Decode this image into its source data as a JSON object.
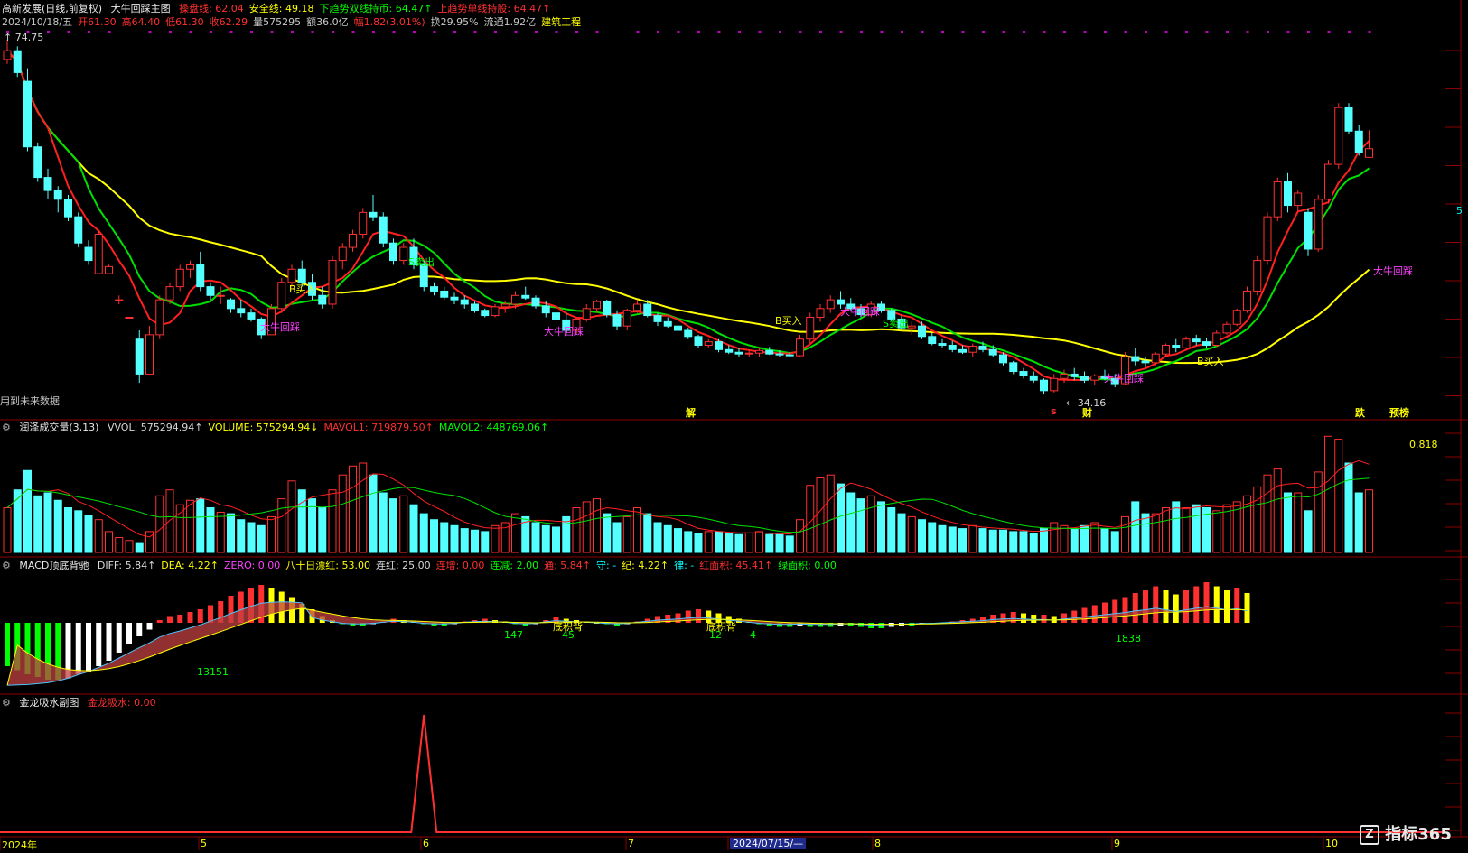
{
  "header": {
    "stock": "高新发展(日线,前复权)",
    "indicator": "大牛回踩主图",
    "params": [
      {
        "text": "操盘线: 62.04",
        "color": "#ff3030"
      },
      {
        "text": "安全线: 49.18",
        "color": "#ffff00"
      },
      {
        "text": "下趋势双线持币: 64.47↑",
        "color": "#00ff00"
      },
      {
        "text": "上趋势单线持股: 64.47↑",
        "color": "#ff3030"
      }
    ],
    "row2": [
      {
        "text": "2024/10/18/五",
        "color": "#c8c8c8"
      },
      {
        "text": "开61.30",
        "color": "#ff3030"
      },
      {
        "text": "高64.40",
        "color": "#ff3030"
      },
      {
        "text": "低61.30",
        "color": "#ff3030"
      },
      {
        "text": "收62.29",
        "color": "#ff3030"
      },
      {
        "text": "量575295",
        "color": "#c8c8c8"
      },
      {
        "text": "额36.0亿",
        "color": "#c8c8c8"
      },
      {
        "text": "幅1.82(3.01%)",
        "color": "#ff3030"
      },
      {
        "text": "换29.95%",
        "color": "#c8c8c8"
      },
      {
        "text": "流通1.92亿",
        "color": "#c8c8c8"
      },
      {
        "text": "建筑工程",
        "color": "#ffff00"
      }
    ]
  },
  "main": {
    "high_label": "74.75",
    "low_label": "34.16",
    "future_note": "用到未来数据",
    "signals": [
      {
        "text": "大牛回踩",
        "color": "#ff40ff"
      },
      {
        "text": "B买入",
        "color": "#ffff00"
      },
      {
        "text": "S卖出",
        "color": "#00ff00"
      },
      {
        "text": "大牛回踩",
        "color": "#ff40ff"
      },
      {
        "text": "B买入",
        "color": "#ffff00"
      },
      {
        "text": "大牛回踩",
        "color": "#ff40ff"
      },
      {
        "text": "S卖出",
        "color": "#00ff00"
      },
      {
        "text": "大牛回踩",
        "color": "#ff40ff"
      },
      {
        "text": "B买入",
        "color": "#ffff00"
      },
      {
        "text": "大牛回踩",
        "color": "#ff40ff"
      }
    ],
    "events": [
      {
        "text": "解",
        "color": "#ffff00"
      },
      {
        "text": "s",
        "color": "#ff3030"
      },
      {
        "text": "财",
        "color": "#ffff00"
      },
      {
        "text": "跌",
        "color": "#ffff00"
      },
      {
        "text": "预榜",
        "color": "#ffff00"
      }
    ],
    "right_mark": "5"
  },
  "volume": {
    "title": "润泽成交量(3,13)",
    "items": [
      {
        "text": "VVOL: 575294.94↑",
        "color": "#d8d8d8"
      },
      {
        "text": "VOLUME: 575294.94↓",
        "color": "#ffff00"
      },
      {
        "text": "MAVOL1: 719879.50↑",
        "color": "#ff3030"
      },
      {
        "text": "MAVOL2: 448769.06↑",
        "color": "#00ff00"
      }
    ],
    "peak_label": "0.818"
  },
  "macd": {
    "title": "MACD顶底背驰",
    "items": [
      {
        "text": "DIFF: 5.84↑",
        "color": "#d8d8d8"
      },
      {
        "text": "DEA: 4.22↑",
        "color": "#ffff00"
      },
      {
        "text": "ZERO: 0.00",
        "color": "#ff40ff"
      },
      {
        "text": "八十日漂红: 53.00",
        "color": "#ffff00"
      },
      {
        "text": "连红: 25.00",
        "color": "#d8d8d8"
      },
      {
        "text": "连增: 0.00",
        "color": "#ff3030"
      },
      {
        "text": "连减: 2.00",
        "color": "#00ff00"
      },
      {
        "text": "通: 5.84↑",
        "color": "#ff3030"
      },
      {
        "text": "守: -",
        "color": "#00ffff"
      },
      {
        "text": "纪: 4.22↑",
        "color": "#ffff00"
      },
      {
        "text": "律: -",
        "color": "#00ffff"
      },
      {
        "text": "红面积: 45.41↑",
        "color": "#ff3030"
      },
      {
        "text": "绿面积: 0.00",
        "color": "#00ff00"
      }
    ],
    "marks": [
      "13151",
      "147",
      "45",
      "12",
      "4",
      "1838"
    ],
    "bei": [
      "底积背",
      "底积背"
    ]
  },
  "jl": {
    "title": "金龙吸水副图",
    "value": "金龙吸水: 0.00"
  },
  "xaxis": {
    "labels": [
      "2024年",
      "5",
      "6",
      "7",
      "2024/07/15/—",
      "8",
      "9",
      "10"
    ]
  },
  "watermark": "指标365",
  "colors": {
    "up": "#ff3030",
    "down": "#54ffff",
    "ma_fast": "#ff2020",
    "ma_slow": "#00e000",
    "ma_long": "#ffff00",
    "border": "#8b0000"
  },
  "chart_data": {
    "type": "candlestick",
    "candles": [
      [
        72.5,
        74.75,
        72.0,
        73.5
      ],
      [
        73.5,
        74.0,
        70.5,
        71.0
      ],
      [
        70.0,
        71.5,
        62.0,
        62.5
      ],
      [
        62.5,
        63.0,
        58.5,
        59.0
      ],
      [
        59.0,
        60.0,
        56.5,
        57.5
      ],
      [
        57.5,
        58.0,
        55.0,
        56.5
      ],
      [
        56.5,
        57.0,
        54.0,
        54.5
      ],
      [
        54.5,
        55.0,
        51.0,
        51.5
      ],
      [
        51.0,
        51.8,
        49.0,
        49.5
      ],
      [
        48.0,
        53.0,
        48.0,
        52.5
      ],
      [
        48.0,
        49.0,
        48.0,
        48.8
      ],
      [
        45.0,
        45.5,
        44.5,
        45.0
      ],
      [
        43.0,
        43.0,
        43.0,
        43.0
      ],
      [
        40.5,
        41.5,
        35.5,
        36.5
      ],
      [
        36.5,
        42.0,
        36.5,
        41.0
      ],
      [
        41.0,
        45.5,
        40.5,
        45.0
      ],
      [
        45.0,
        47.0,
        44.5,
        46.5
      ],
      [
        46.5,
        49.0,
        46.0,
        48.5
      ],
      [
        48.5,
        49.5,
        47.5,
        49.0
      ],
      [
        49.0,
        50.5,
        46.0,
        46.5
      ],
      [
        46.5,
        47.0,
        45.0,
        45.5
      ],
      [
        45.5,
        46.5,
        44.5,
        45.5
      ],
      [
        45.0,
        45.2,
        43.5,
        44.0
      ],
      [
        44.0,
        45.0,
        43.0,
        43.5
      ],
      [
        43.5,
        44.0,
        42.5,
        42.8
      ],
      [
        42.8,
        43.0,
        40.5,
        41.0
      ],
      [
        41.0,
        44.5,
        41.0,
        44.0
      ],
      [
        44.0,
        47.5,
        43.5,
        47.0
      ],
      [
        47.0,
        49.0,
        46.5,
        48.5
      ],
      [
        48.5,
        49.5,
        46.5,
        47.0
      ],
      [
        47.0,
        48.0,
        45.0,
        45.5
      ],
      [
        45.5,
        46.5,
        44.0,
        44.5
      ],
      [
        44.5,
        50.0,
        44.0,
        49.5
      ],
      [
        49.5,
        51.5,
        48.5,
        51.0
      ],
      [
        51.0,
        53.0,
        50.5,
        52.5
      ],
      [
        52.5,
        55.5,
        52.0,
        55.0
      ],
      [
        55.0,
        57.0,
        54.0,
        54.5
      ],
      [
        54.5,
        55.0,
        51.0,
        51.5
      ],
      [
        51.5,
        52.0,
        49.0,
        49.5
      ],
      [
        49.5,
        51.5,
        49.0,
        51.0
      ],
      [
        51.0,
        52.0,
        48.5,
        49.0
      ],
      [
        49.0,
        49.5,
        46.0,
        46.5
      ],
      [
        46.5,
        47.0,
        45.5,
        46.0
      ],
      [
        46.0,
        46.5,
        45.0,
        45.3
      ],
      [
        45.3,
        45.8,
        44.5,
        45.0
      ],
      [
        45.0,
        45.5,
        44.0,
        44.5
      ],
      [
        44.5,
        44.8,
        43.5,
        43.8
      ],
      [
        43.8,
        44.0,
        43.0,
        43.2
      ],
      [
        43.2,
        44.5,
        43.0,
        44.2
      ],
      [
        44.2,
        44.8,
        43.5,
        44.5
      ],
      [
        44.5,
        46.0,
        44.0,
        45.5
      ],
      [
        45.5,
        46.5,
        45.0,
        45.2
      ],
      [
        45.2,
        45.5,
        44.0,
        44.3
      ],
      [
        44.3,
        44.8,
        43.0,
        43.5
      ],
      [
        43.5,
        44.0,
        42.5,
        42.7
      ],
      [
        42.7,
        43.5,
        41.0,
        41.5
      ],
      [
        41.5,
        43.0,
        41.0,
        42.8
      ],
      [
        42.8,
        44.5,
        42.5,
        44.0
      ],
      [
        44.0,
        45.0,
        43.5,
        44.8
      ],
      [
        44.8,
        45.0,
        43.0,
        43.3
      ],
      [
        43.3,
        43.8,
        41.5,
        42.0
      ],
      [
        42.0,
        44.0,
        41.5,
        43.8
      ],
      [
        43.8,
        45.0,
        43.5,
        44.5
      ],
      [
        44.5,
        45.0,
        43.0,
        43.2
      ],
      [
        43.2,
        43.5,
        42.0,
        42.5
      ],
      [
        42.5,
        43.0,
        41.8,
        42.0
      ],
      [
        42.0,
        42.5,
        41.0,
        41.5
      ],
      [
        41.5,
        41.8,
        40.5,
        40.8
      ],
      [
        40.8,
        41.0,
        39.5,
        39.8
      ],
      [
        39.8,
        40.5,
        39.5,
        40.2
      ],
      [
        40.2,
        40.5,
        39.0,
        39.3
      ],
      [
        39.3,
        39.8,
        38.8,
        39.0
      ],
      [
        39.0,
        39.5,
        38.5,
        38.8
      ],
      [
        38.8,
        39.2,
        38.5,
        38.9
      ],
      [
        38.9,
        39.5,
        38.5,
        39.2
      ],
      [
        39.2,
        39.6,
        38.7,
        38.8
      ],
      [
        38.8,
        39.2,
        38.5,
        38.7
      ],
      [
        38.7,
        39.0,
        38.4,
        38.6
      ],
      [
        38.6,
        41.0,
        38.5,
        40.5
      ],
      [
        40.5,
        43.5,
        40.0,
        43.0
      ],
      [
        43.0,
        44.5,
        42.5,
        44.0
      ],
      [
        44.0,
        45.5,
        43.5,
        45.0
      ],
      [
        45.0,
        46.0,
        44.0,
        44.5
      ],
      [
        44.5,
        45.2,
        43.8,
        44.0
      ],
      [
        44.0,
        44.5,
        43.0,
        43.3
      ],
      [
        43.3,
        44.8,
        43.0,
        44.5
      ],
      [
        44.5,
        44.8,
        43.5,
        43.8
      ],
      [
        43.8,
        44.0,
        42.5,
        42.8
      ],
      [
        42.8,
        43.2,
        41.5,
        41.8
      ],
      [
        41.8,
        42.5,
        41.0,
        42.0
      ],
      [
        42.0,
        42.5,
        40.5,
        40.8
      ],
      [
        40.8,
        41.2,
        39.8,
        40.0
      ],
      [
        40.0,
        40.5,
        39.5,
        39.8
      ],
      [
        39.8,
        40.3,
        39.0,
        39.3
      ],
      [
        39.3,
        39.8,
        38.8,
        39.0
      ],
      [
        39.0,
        40.0,
        38.5,
        39.7
      ],
      [
        39.7,
        40.2,
        39.0,
        39.3
      ],
      [
        39.3,
        39.8,
        38.5,
        38.7
      ],
      [
        38.7,
        39.0,
        37.5,
        37.8
      ],
      [
        37.8,
        38.0,
        36.5,
        36.8
      ],
      [
        36.8,
        37.2,
        36.0,
        36.3
      ],
      [
        36.3,
        36.8,
        35.5,
        35.8
      ],
      [
        35.8,
        36.0,
        34.16,
        34.6
      ],
      [
        34.6,
        36.5,
        34.4,
        36.0
      ],
      [
        36.0,
        37.0,
        35.5,
        36.5
      ],
      [
        36.5,
        37.2,
        35.8,
        36.2
      ],
      [
        36.2,
        36.8,
        35.5,
        35.8
      ],
      [
        35.8,
        36.5,
        35.3,
        36.3
      ],
      [
        36.3,
        37.0,
        35.8,
        36.0
      ],
      [
        36.0,
        36.5,
        35.0,
        35.4
      ],
      [
        35.4,
        39.0,
        35.2,
        38.5
      ],
      [
        38.5,
        39.5,
        37.5,
        38.0
      ],
      [
        38.0,
        38.5,
        37.3,
        37.8
      ],
      [
        37.8,
        39.0,
        37.5,
        38.8
      ],
      [
        38.8,
        40.0,
        38.5,
        39.8
      ],
      [
        39.8,
        40.5,
        39.0,
        39.5
      ],
      [
        39.5,
        40.8,
        39.3,
        40.5
      ],
      [
        40.5,
        41.0,
        39.8,
        40.2
      ],
      [
        40.2,
        40.6,
        39.5,
        39.8
      ],
      [
        39.8,
        41.5,
        39.6,
        41.2
      ],
      [
        41.2,
        42.5,
        41.0,
        42.2
      ],
      [
        42.2,
        44.0,
        42.0,
        43.8
      ],
      [
        43.8,
        46.5,
        43.5,
        46.0
      ],
      [
        46.0,
        50.0,
        45.5,
        49.5
      ],
      [
        49.5,
        55.0,
        49.0,
        54.5
      ],
      [
        54.5,
        59.0,
        54.0,
        58.5
      ],
      [
        58.5,
        59.5,
        55.0,
        55.8
      ],
      [
        55.8,
        57.5,
        55.0,
        57.2
      ],
      [
        55.0,
        55.5,
        50.0,
        50.8
      ],
      [
        50.8,
        57.0,
        50.5,
        56.5
      ],
      [
        56.5,
        61.0,
        56.0,
        60.5
      ],
      [
        60.5,
        67.5,
        60.0,
        67.0
      ],
      [
        67.0,
        67.5,
        64.0,
        64.3
      ],
      [
        64.3,
        65.0,
        61.5,
        61.8
      ],
      [
        61.3,
        64.4,
        61.3,
        62.29
      ]
    ],
    "volume": [
      30,
      42,
      55,
      38,
      40,
      35,
      30,
      28,
      25,
      22,
      14,
      10,
      8,
      6,
      14,
      38,
      42,
      32,
      35,
      36,
      30,
      27,
      26,
      22,
      20,
      18,
      24,
      36,
      48,
      42,
      36,
      30,
      42,
      52,
      58,
      60,
      52,
      40,
      36,
      38,
      32,
      26,
      22,
      20,
      18,
      16,
      15,
      14,
      18,
      20,
      26,
      24,
      20,
      18,
      17,
      24,
      30,
      34,
      36,
      26,
      20,
      24,
      30,
      26,
      20,
      18,
      16,
      14,
      13,
      14,
      14,
      13,
      12,
      13,
      14,
      12,
      12,
      11,
      22,
      45,
      50,
      52,
      46,
      40,
      36,
      38,
      34,
      30,
      26,
      24,
      22,
      20,
      18,
      17,
      16,
      18,
      16,
      15,
      15,
      14,
      14,
      13,
      16,
      20,
      18,
      16,
      18,
      20,
      16,
      14,
      24,
      34,
      26,
      26,
      30,
      34,
      30,
      32,
      30,
      28,
      32,
      34,
      38,
      44,
      52,
      56,
      40,
      40,
      28,
      54,
      78,
      76,
      60,
      40,
      42
    ],
    "macd_hist": [
      -3.2,
      -3.5,
      -3.8,
      -4.0,
      -4.2,
      -4.2,
      -4.1,
      -3.8,
      -3.6,
      -3.2,
      -2.8,
      -2.2,
      -1.6,
      -1.0,
      -0.5,
      0.2,
      0.5,
      0.6,
      0.8,
      1.0,
      1.3,
      1.6,
      2.0,
      2.3,
      2.6,
      2.8,
      2.6,
      2.3,
      1.9,
      1.4,
      1.0,
      0.5,
      0.2,
      -0.1,
      -0.2,
      -0.2,
      -0.1,
      0.1,
      0.3,
      0.2,
      0.1,
      -0.1,
      -0.2,
      -0.2,
      -0.1,
      0.1,
      0.2,
      0.3,
      0.2,
      0.1,
      -0.1,
      -0.2,
      -0.1,
      0.2,
      0.4,
      0.3,
      0.2,
      0.1,
      0.0,
      -0.1,
      -0.2,
      -0.1,
      0.1,
      0.3,
      0.5,
      0.6,
      0.7,
      0.9,
      1.0,
      0.9,
      0.7,
      0.5,
      0.3,
      0.1,
      -0.1,
      -0.2,
      -0.3,
      -0.3,
      -0.2,
      -0.3,
      -0.3,
      -0.3,
      -0.2,
      -0.2,
      -0.3,
      -0.4,
      -0.4,
      -0.3,
      -0.2,
      -0.2,
      -0.1,
      -0.1,
      0.0,
      0.1,
      0.2,
      0.3,
      0.4,
      0.6,
      0.7,
      0.8,
      0.7,
      0.6,
      0.6,
      0.5,
      0.7,
      0.9,
      1.1,
      1.3,
      1.5,
      1.7,
      1.9,
      2.2,
      2.4,
      2.7,
      2.4,
      2.1,
      2.4,
      2.7,
      3.0,
      2.7,
      2.4,
      2.6,
      2.2
    ],
    "jl_spike_index": 41
  }
}
